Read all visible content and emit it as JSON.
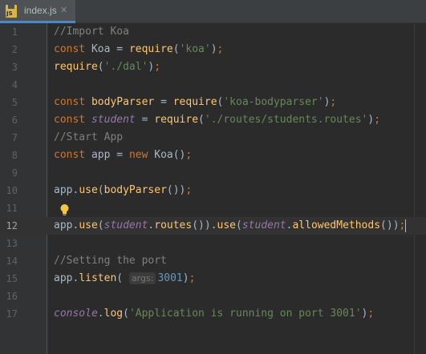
{
  "tab": {
    "label": "index.js",
    "icon": "js-file-icon",
    "icon_text": "JS"
  },
  "colors": {
    "background": "#2b2b2b",
    "keyword": "#cc7832",
    "string": "#6a8759",
    "comment": "#808080",
    "function": "#ffc66d",
    "italic_identifier": "#9876aa",
    "number": "#6897bb",
    "plain": "#a9b7c6"
  },
  "editor": {
    "current_line": 12,
    "line_numbers": [
      "1",
      "2",
      "3",
      "4",
      "5",
      "6",
      "7",
      "8",
      "9",
      "10",
      "11",
      "12",
      "13",
      "14",
      "15",
      "16",
      "17"
    ],
    "lines": [
      [
        {
          "t": "cm",
          "v": "//Import Koa"
        }
      ],
      [
        {
          "t": "kw",
          "v": "const "
        },
        {
          "t": "p",
          "v": "Koa = "
        },
        {
          "t": "fn",
          "v": "require"
        },
        {
          "t": "p",
          "v": "("
        },
        {
          "t": "str",
          "v": "'koa'"
        },
        {
          "t": "p",
          "v": ")"
        },
        {
          "t": "kw",
          "v": ";"
        }
      ],
      [
        {
          "t": "fn",
          "v": "require"
        },
        {
          "t": "p",
          "v": "("
        },
        {
          "t": "str",
          "v": "'./dal'"
        },
        {
          "t": "p",
          "v": ")"
        },
        {
          "t": "kw",
          "v": ";"
        }
      ],
      [],
      [
        {
          "t": "kw",
          "v": "const "
        },
        {
          "t": "fn",
          "v": "bodyParser"
        },
        {
          "t": "p",
          "v": " = "
        },
        {
          "t": "fn",
          "v": "require"
        },
        {
          "t": "p",
          "v": "("
        },
        {
          "t": "str",
          "v": "'koa-bodyparser'"
        },
        {
          "t": "p",
          "v": ")"
        },
        {
          "t": "kw",
          "v": ";"
        }
      ],
      [
        {
          "t": "kw",
          "v": "const "
        },
        {
          "t": "ital",
          "v": "student"
        },
        {
          "t": "p",
          "v": " = "
        },
        {
          "t": "fn",
          "v": "require"
        },
        {
          "t": "p",
          "v": "("
        },
        {
          "t": "str",
          "v": "'./routes/students.routes'"
        },
        {
          "t": "p",
          "v": ")"
        },
        {
          "t": "kw",
          "v": ";"
        }
      ],
      [
        {
          "t": "cm",
          "v": "//Start App"
        }
      ],
      [
        {
          "t": "kw",
          "v": "const "
        },
        {
          "t": "p",
          "v": "app = "
        },
        {
          "t": "kw",
          "v": "new "
        },
        {
          "t": "p",
          "v": "Koa()"
        },
        {
          "t": "kw",
          "v": ";"
        }
      ],
      [],
      [
        {
          "t": "p",
          "v": "app."
        },
        {
          "t": "fn",
          "v": "use"
        },
        {
          "t": "p",
          "v": "("
        },
        {
          "t": "fn",
          "v": "bodyParser"
        },
        {
          "t": "p",
          "v": "())"
        },
        {
          "t": "kw",
          "v": ";"
        }
      ],
      [],
      [
        {
          "t": "p",
          "v": "app."
        },
        {
          "t": "fn",
          "v": "use"
        },
        {
          "t": "p",
          "v": "("
        },
        {
          "t": "ital",
          "v": "student"
        },
        {
          "t": "p",
          "v": "."
        },
        {
          "t": "fn",
          "v": "routes"
        },
        {
          "t": "p",
          "v": "())."
        },
        {
          "t": "fn",
          "v": "use"
        },
        {
          "t": "p",
          "v": "("
        },
        {
          "t": "ital",
          "v": "student"
        },
        {
          "t": "p",
          "v": "."
        },
        {
          "t": "fn",
          "v": "allowedMethods"
        },
        {
          "t": "p",
          "v": "())"
        },
        {
          "t": "kw",
          "v": ";"
        },
        {
          "t": "caret",
          "v": ""
        }
      ],
      [],
      [
        {
          "t": "cm",
          "v": "//Setting the port"
        }
      ],
      [
        {
          "t": "p",
          "v": "app."
        },
        {
          "t": "fn",
          "v": "listen"
        },
        {
          "t": "p",
          "v": "( "
        },
        {
          "t": "hint",
          "v": "args:"
        },
        {
          "t": "num",
          "v": "3001"
        },
        {
          "t": "p",
          "v": ")"
        },
        {
          "t": "kw",
          "v": ";"
        }
      ],
      [],
      [
        {
          "t": "ital",
          "v": "console"
        },
        {
          "t": "p",
          "v": "."
        },
        {
          "t": "fn",
          "v": "log"
        },
        {
          "t": "p",
          "v": "("
        },
        {
          "t": "str",
          "v": "'Application is running on port 3001'"
        },
        {
          "t": "p",
          "v": ")"
        },
        {
          "t": "kw",
          "v": ";"
        }
      ]
    ],
    "intention_icon": "lightbulb-icon"
  }
}
